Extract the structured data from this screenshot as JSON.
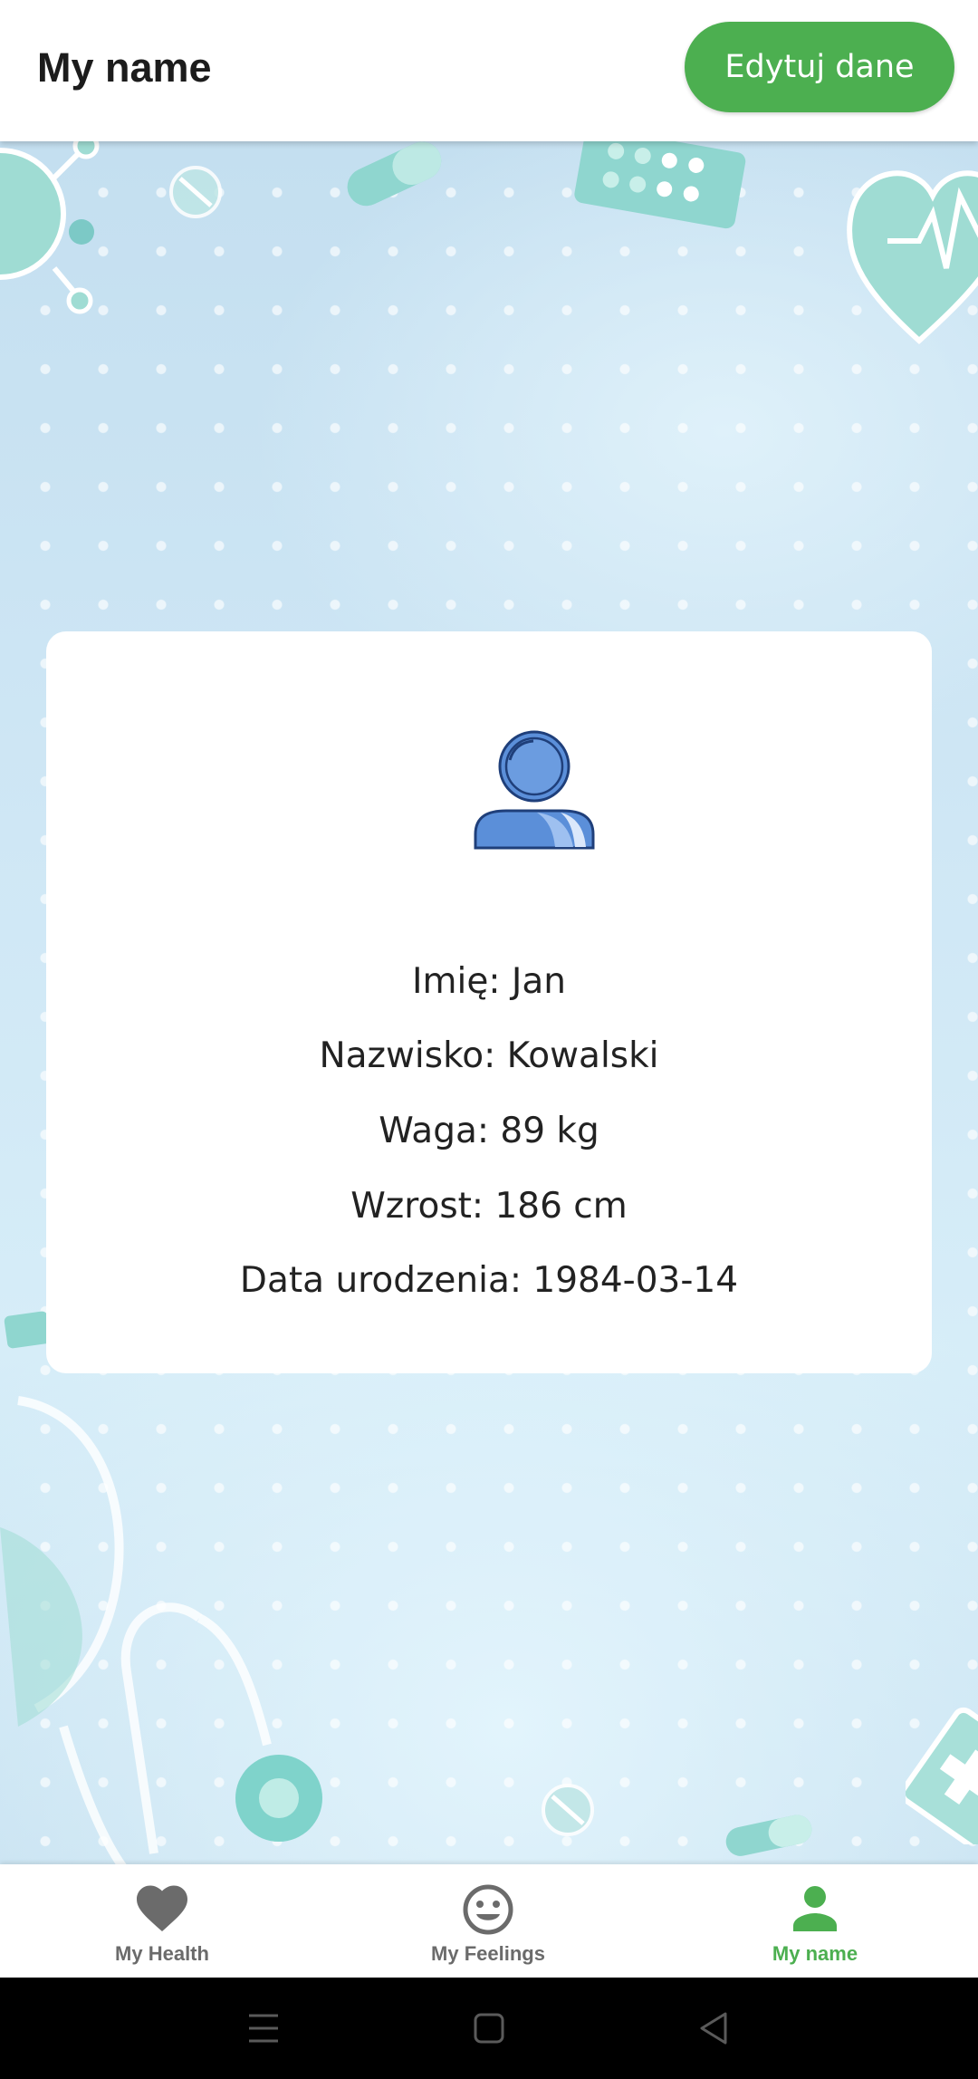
{
  "appbar": {
    "title": "My name",
    "edit_button_label": "Edytuj dane"
  },
  "profile": {
    "avatar_icon": "person-avatar-icon",
    "lines": [
      "Imię: Jan",
      "Nazwisko: Kowalski",
      "Waga: 89 kg",
      "Wzrost: 186 cm",
      "Data urodzenia: 1984-03-14"
    ]
  },
  "bottom_nav": {
    "items": [
      {
        "label": "My Health",
        "icon": "heart-icon",
        "active": false
      },
      {
        "label": "My Feelings",
        "icon": "smiley-face-icon",
        "active": false
      },
      {
        "label": "My name",
        "icon": "person-icon",
        "active": true
      }
    ]
  },
  "system_nav": {
    "icons": [
      "recent-apps-icon",
      "home-icon",
      "back-icon"
    ]
  },
  "colors": {
    "accent": "#4caf50",
    "inactive": "#6b6b6b",
    "avatar_blue": "#5b8fd9",
    "avatar_outline": "#1f3f7a"
  }
}
